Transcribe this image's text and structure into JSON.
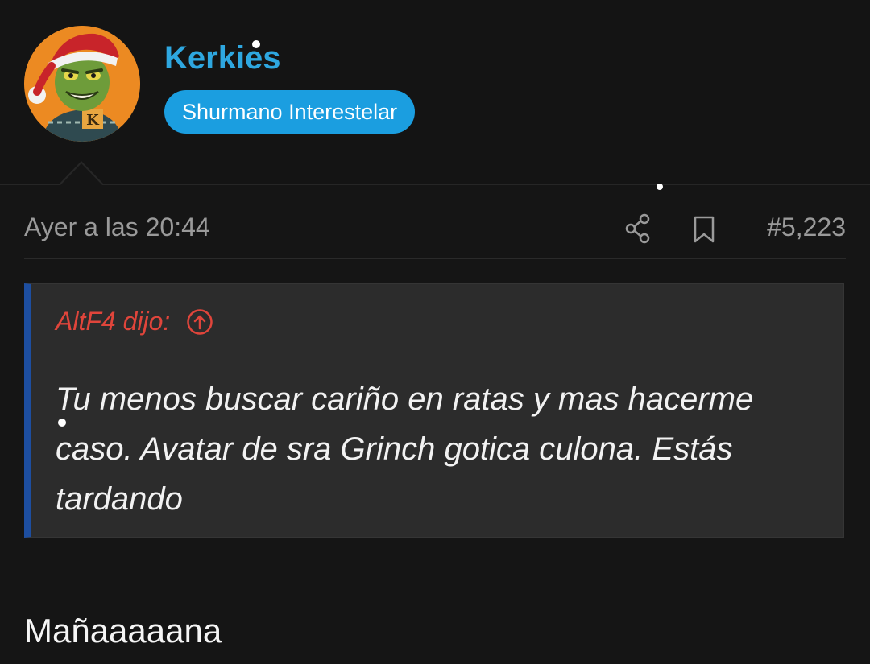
{
  "user": {
    "name": "Kerkies",
    "title": "Shurmano Interestelar",
    "avatar_badge": "K"
  },
  "post": {
    "date": "Ayer a las 20:44",
    "number": "#5,223",
    "share_icon": "share-icon",
    "bookmark_icon": "bookmark-icon"
  },
  "quote": {
    "author": "AltF4 dijo:",
    "jump_icon": "arrow-up-circle-icon",
    "text": "Tu menos buscar cariño en ratas y mas hacerme caso. Avatar de sra Grinch gotica culona. Estás tardando"
  },
  "message": {
    "text": "Mañaaaaana"
  },
  "colors": {
    "username": "#2ea7e0",
    "title_badge": "#1b9ee0",
    "quote_author": "#e0453b",
    "quote_border": "#1d4ea0",
    "background": "#151515"
  }
}
